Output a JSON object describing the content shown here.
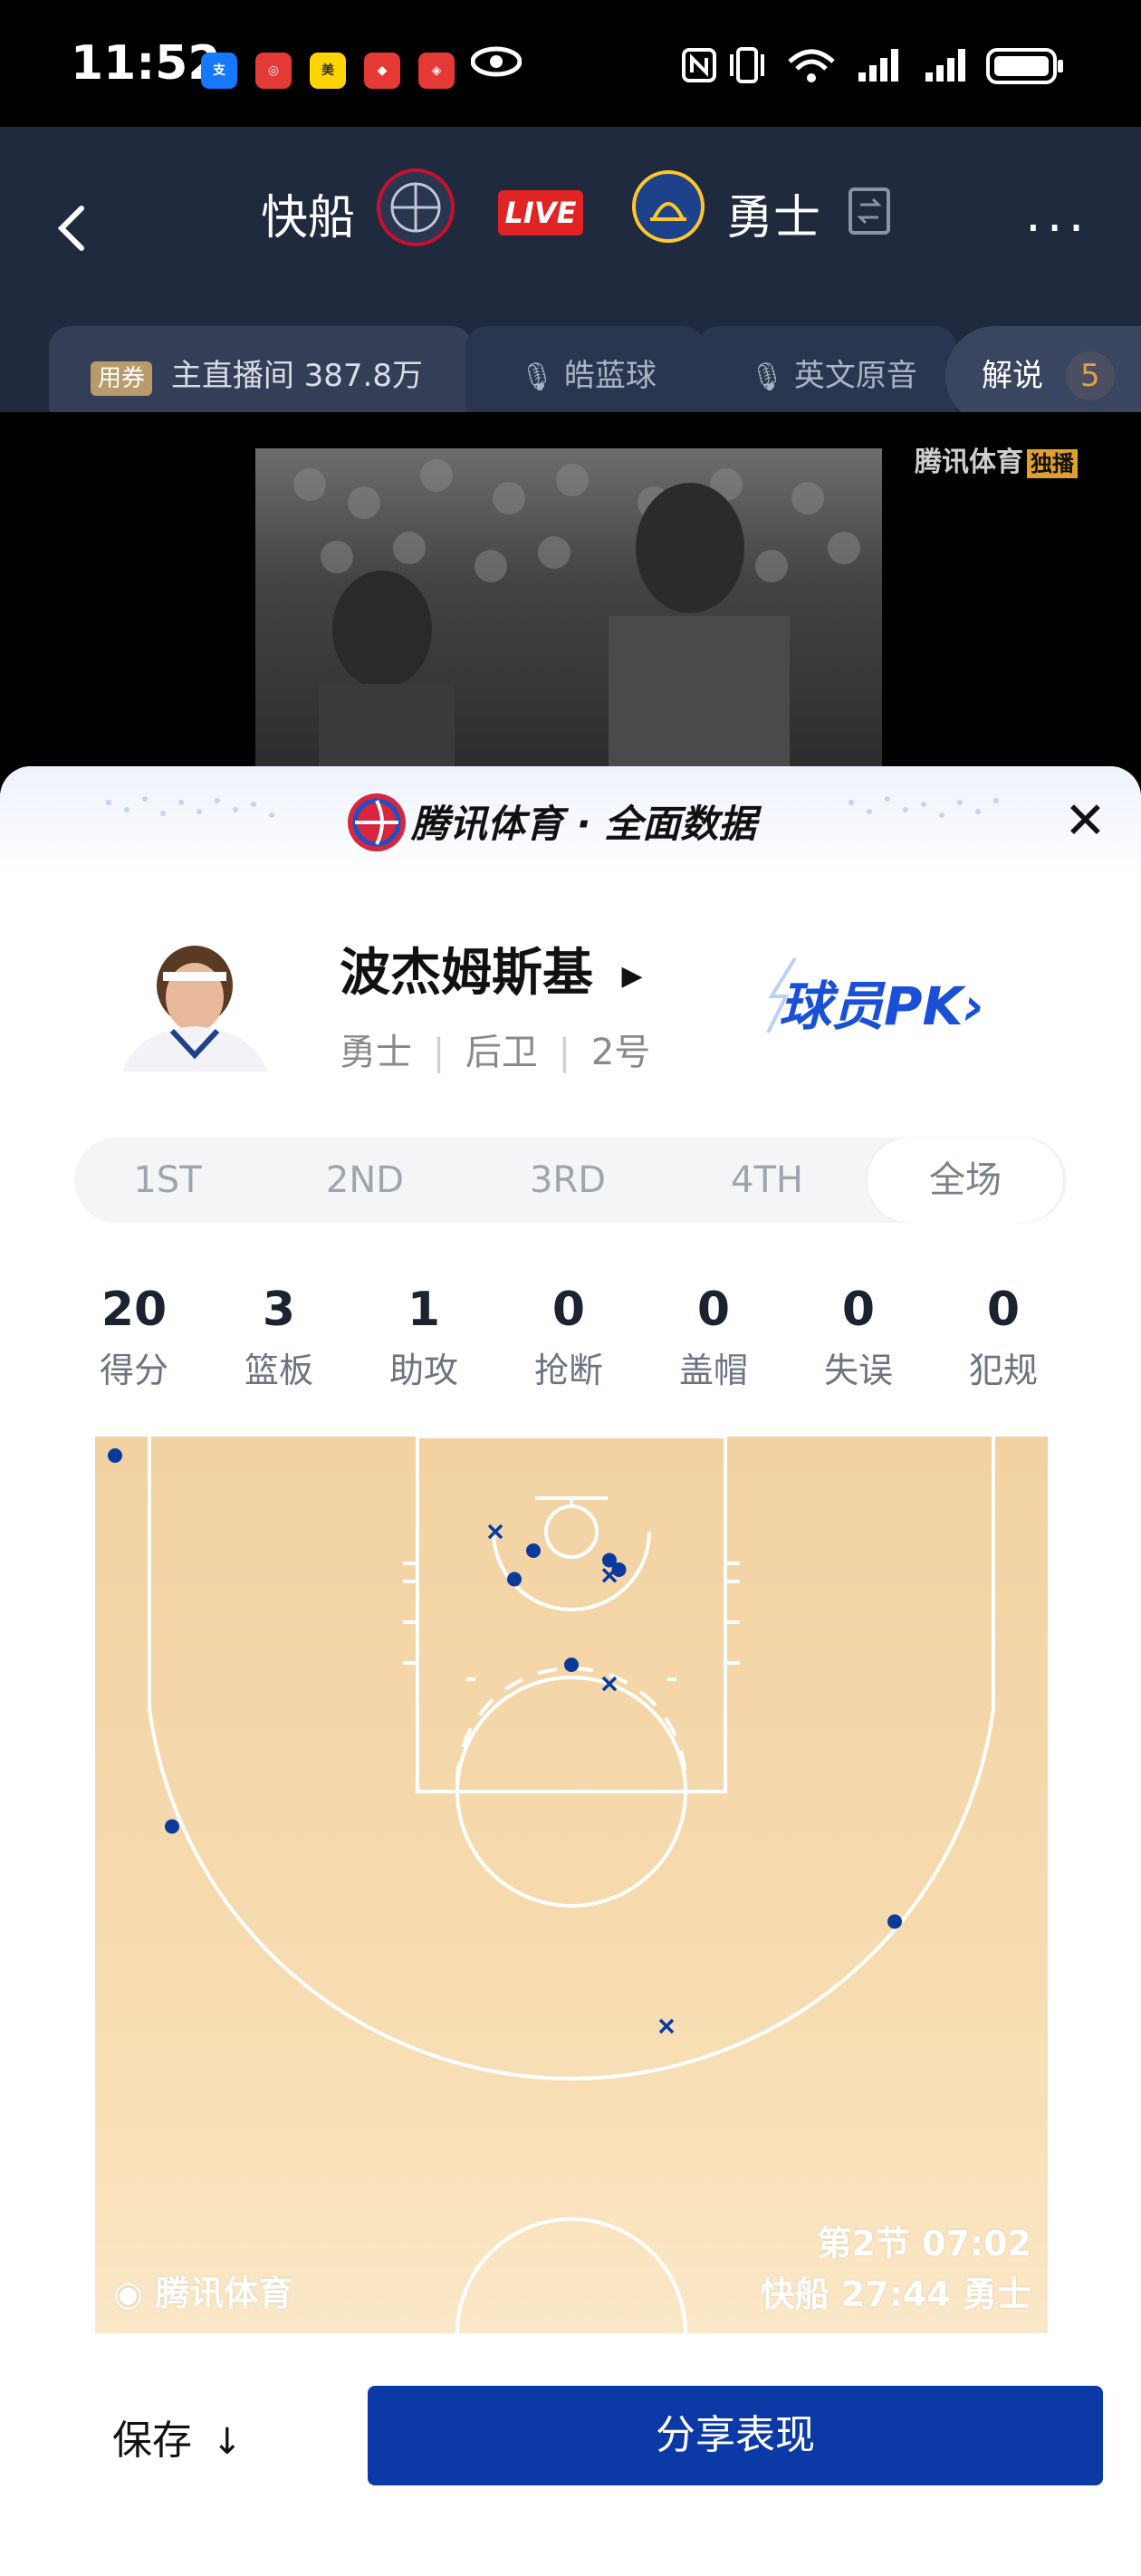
{
  "status_bar": {
    "time": "11:52"
  },
  "header": {
    "home_team": "快船",
    "away_team": "勇士",
    "live_label": "LIVE",
    "tabs": [
      {
        "tag": "用券",
        "label": "主直播间 387.8万"
      },
      {
        "label": "皓蓝球"
      },
      {
        "label": "英文原音"
      },
      {
        "label": "解说",
        "count": "5"
      }
    ]
  },
  "video": {
    "watermark": "腾讯体育",
    "watermark_badge": "独播"
  },
  "sheet": {
    "banner_title": "腾讯体育 · 全面数据",
    "player": {
      "name": "波杰姆斯基",
      "team": "勇士",
      "position": "后卫",
      "number": "2号"
    },
    "pk_label": "球员PK",
    "periods": [
      "1ST",
      "2ND",
      "3RD",
      "4TH",
      "全场"
    ],
    "selected_period": "全场",
    "stats": [
      {
        "value": "20",
        "label": "得分"
      },
      {
        "value": "3",
        "label": "篮板"
      },
      {
        "value": "1",
        "label": "助攻"
      },
      {
        "value": "0",
        "label": "抢断"
      },
      {
        "value": "0",
        "label": "盖帽"
      },
      {
        "value": "0",
        "label": "失误"
      },
      {
        "value": "0",
        "label": "犯规"
      }
    ],
    "court": {
      "brand": "腾讯体育",
      "game_clock": "第2节 07:02",
      "scoreline": "快船 27:44 勇士",
      "shots": [
        {
          "x": -24.0,
          "y": 1.0,
          "made": true
        },
        {
          "x": -21.0,
          "y": 20.5,
          "made": true
        },
        {
          "x": 17.0,
          "y": 25.5,
          "made": true
        },
        {
          "x": 5.0,
          "y": 31.0,
          "made": false
        },
        {
          "x": -4.0,
          "y": 5.0,
          "made": false
        },
        {
          "x": -2.0,
          "y": 6.0,
          "made": true
        },
        {
          "x": -3.0,
          "y": 7.5,
          "made": true
        },
        {
          "x": 2.0,
          "y": 6.5,
          "made": true
        },
        {
          "x": 2.5,
          "y": 7.0,
          "made": true
        },
        {
          "x": 2.0,
          "y": 7.3,
          "made": false
        },
        {
          "x": 0.0,
          "y": 12.0,
          "made": true
        },
        {
          "x": 2.0,
          "y": 13.0,
          "made": false
        }
      ],
      "colors": {
        "made": "#0b3a9c",
        "missed": "#0b3a9c",
        "lines": "#ffffff"
      }
    },
    "actions": {
      "save_label": "保存",
      "share_label": "分享表现"
    }
  }
}
